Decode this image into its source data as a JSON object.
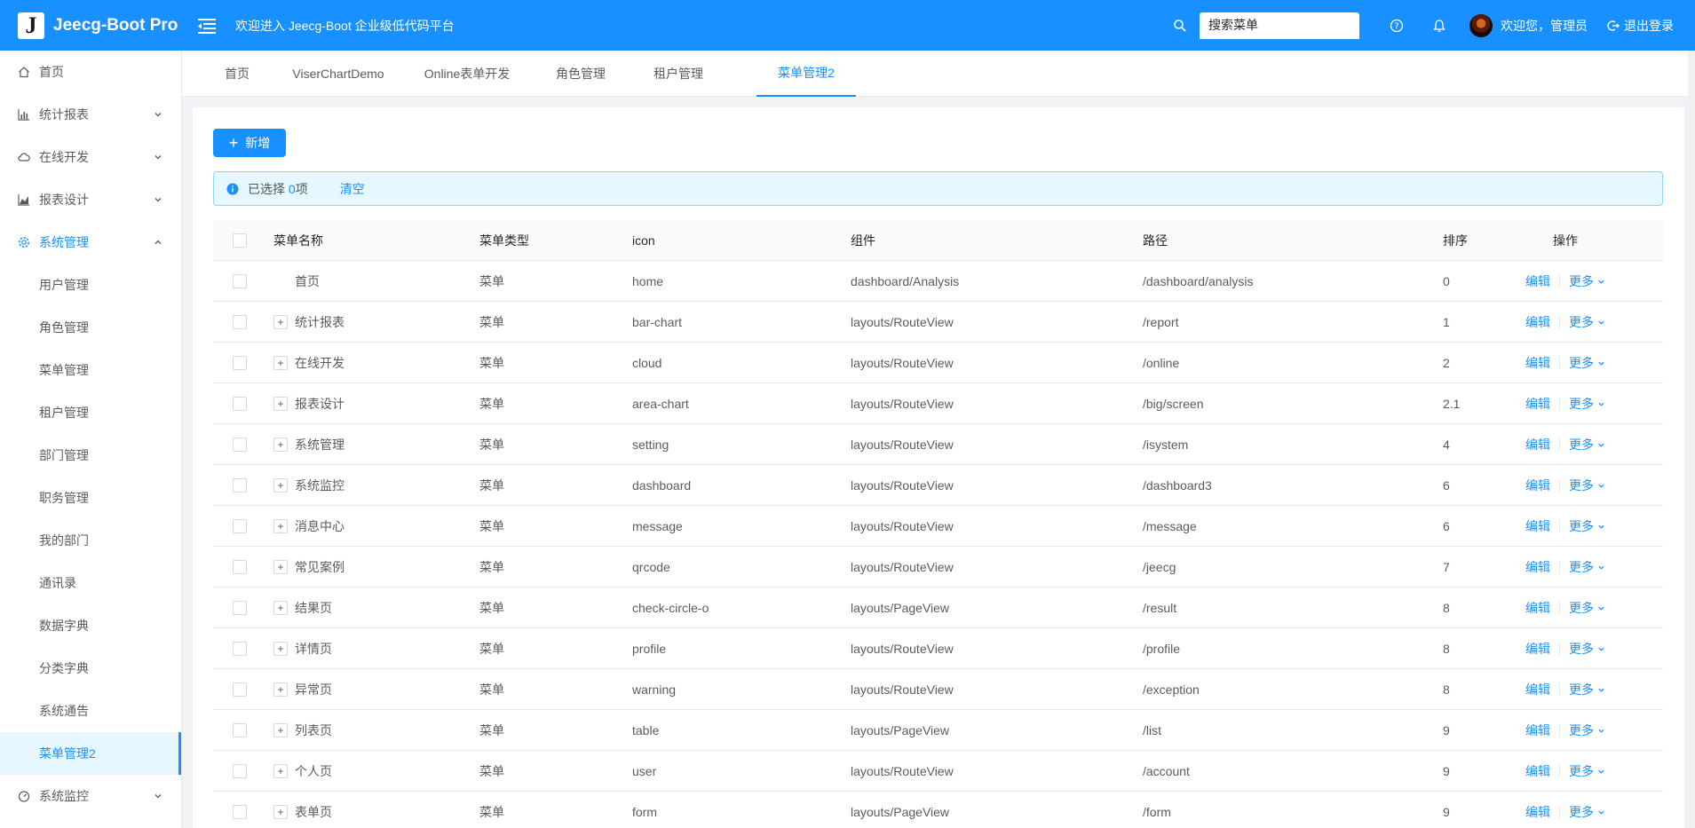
{
  "header": {
    "logo_letter": "J",
    "app_name": "Jeecg-Boot Pro",
    "welcome": "欢迎进入 Jeecg-Boot 企业级低代码平台",
    "search_placeholder": "搜索菜单",
    "user_greeting": "欢迎您，管理员",
    "logout": "退出登录",
    "accent_color": "#1890ff"
  },
  "sidebar": {
    "items": [
      {
        "label": "首页",
        "icon": "home-icon",
        "has_children": false
      },
      {
        "label": "统计报表",
        "icon": "bar-chart-icon",
        "has_children": true
      },
      {
        "label": "在线开发",
        "icon": "cloud-icon",
        "has_children": true
      },
      {
        "label": "报表设计",
        "icon": "area-chart-icon",
        "has_children": true
      },
      {
        "label": "系统管理",
        "icon": "setting-icon",
        "has_children": true,
        "open": true
      }
    ],
    "sub_items": [
      "用户管理",
      "角色管理",
      "菜单管理",
      "租户管理",
      "部门管理",
      "职务管理",
      "我的部门",
      "通讯录",
      "数据字典",
      "分类字典",
      "系统通告",
      "菜单管理2"
    ],
    "active_sub": "菜单管理2",
    "after_items": [
      {
        "label": "系统监控",
        "icon": "dashboard-icon",
        "has_children": true
      }
    ]
  },
  "tabs": [
    "首页",
    "ViserChartDemo",
    "Online表单开发",
    "角色管理",
    "租户管理",
    "菜单管理2"
  ],
  "active_tab": "菜单管理2",
  "toolbar": {
    "add_label": "新增"
  },
  "alert": {
    "prefix": "已选择",
    "count": "0",
    "suffix": "项",
    "clear": "清空"
  },
  "table": {
    "columns": [
      "菜单名称",
      "菜单类型",
      "icon",
      "组件",
      "路径",
      "排序",
      "操作"
    ],
    "edit_label": "编辑",
    "more_label": "更多",
    "rows": [
      {
        "name": "首页",
        "type": "菜单",
        "icon": "home",
        "component": "dashboard/Analysis",
        "path": "/dashboard/analysis",
        "sort": "0",
        "expandable": false
      },
      {
        "name": "统计报表",
        "type": "菜单",
        "icon": "bar-chart",
        "component": "layouts/RouteView",
        "path": "/report",
        "sort": "1",
        "expandable": true
      },
      {
        "name": "在线开发",
        "type": "菜单",
        "icon": "cloud",
        "component": "layouts/RouteView",
        "path": "/online",
        "sort": "2",
        "expandable": true
      },
      {
        "name": "报表设计",
        "type": "菜单",
        "icon": "area-chart",
        "component": "layouts/RouteView",
        "path": "/big/screen",
        "sort": "2.1",
        "expandable": true
      },
      {
        "name": "系统管理",
        "type": "菜单",
        "icon": "setting",
        "component": "layouts/RouteView",
        "path": "/isystem",
        "sort": "4",
        "expandable": true
      },
      {
        "name": "系统监控",
        "type": "菜单",
        "icon": "dashboard",
        "component": "layouts/RouteView",
        "path": "/dashboard3",
        "sort": "6",
        "expandable": true
      },
      {
        "name": "消息中心",
        "type": "菜单",
        "icon": "message",
        "component": "layouts/RouteView",
        "path": "/message",
        "sort": "6",
        "expandable": true
      },
      {
        "name": "常见案例",
        "type": "菜单",
        "icon": "qrcode",
        "component": "layouts/RouteView",
        "path": "/jeecg",
        "sort": "7",
        "expandable": true
      },
      {
        "name": "结果页",
        "type": "菜单",
        "icon": "check-circle-o",
        "component": "layouts/PageView",
        "path": "/result",
        "sort": "8",
        "expandable": true
      },
      {
        "name": "详情页",
        "type": "菜单",
        "icon": "profile",
        "component": "layouts/RouteView",
        "path": "/profile",
        "sort": "8",
        "expandable": true
      },
      {
        "name": "异常页",
        "type": "菜单",
        "icon": "warning",
        "component": "layouts/RouteView",
        "path": "/exception",
        "sort": "8",
        "expandable": true
      },
      {
        "name": "列表页",
        "type": "菜单",
        "icon": "table",
        "component": "layouts/PageView",
        "path": "/list",
        "sort": "9",
        "expandable": true
      },
      {
        "name": "个人页",
        "type": "菜单",
        "icon": "user",
        "component": "layouts/RouteView",
        "path": "/account",
        "sort": "9",
        "expandable": true
      },
      {
        "name": "表单页",
        "type": "菜单",
        "icon": "form",
        "component": "layouts/PageView",
        "path": "/form",
        "sort": "9",
        "expandable": true
      }
    ]
  }
}
